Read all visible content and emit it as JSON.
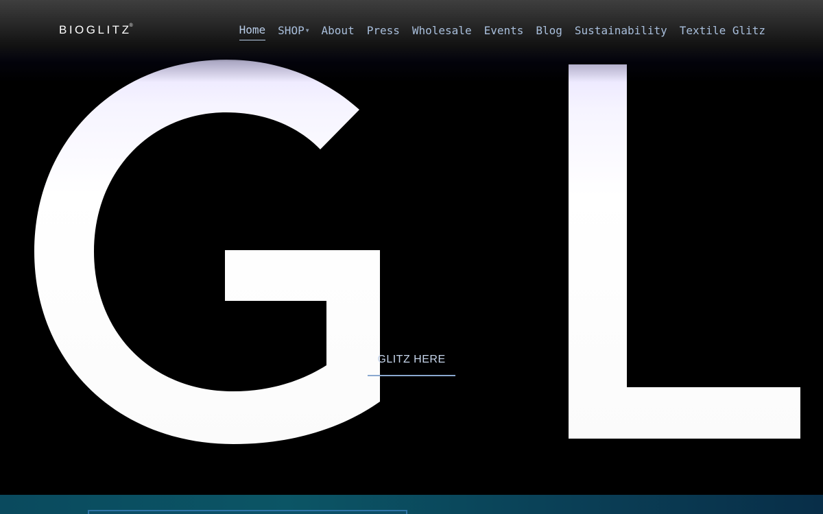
{
  "brand": {
    "logo_text": "BIOGLITZ",
    "logo_mark": "®"
  },
  "nav": {
    "items": [
      {
        "label": "Home",
        "active": true
      },
      {
        "label": "SHOP",
        "has_dropdown": true
      },
      {
        "label": "About"
      },
      {
        "label": "Press"
      },
      {
        "label": "Wholesale"
      },
      {
        "label": "Events"
      },
      {
        "label": "Blog"
      },
      {
        "label": "Sustainability"
      },
      {
        "label": "Textile Glitz"
      }
    ],
    "dropdown_icon": "chevron-down-icon"
  },
  "hero": {
    "letters": [
      "G",
      "L"
    ],
    "cta_label": "GLITZ HERE"
  },
  "colors": {
    "nav_text": "#a9bfdc",
    "background": "#000000",
    "letter_fill": "#ffffff",
    "letter_tint": "#ece8ff",
    "cta_underline": "#8aa8cf",
    "strip": "#0b5565",
    "strip_box_border": "#2f74a7"
  }
}
